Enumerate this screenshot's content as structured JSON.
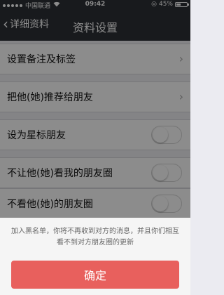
{
  "status_bar": {
    "carrier": "中国联通",
    "time": "09:42",
    "battery": "45%",
    "battery_level": 0.45
  },
  "nav": {
    "back_label": "详细资料",
    "title": "资料设置"
  },
  "rows": {
    "remark_label": "设置备注及标签",
    "recommend_label": "把他(她)推荐给朋友",
    "star_label": "设为星标朋友",
    "block_moments_label": "不让他(她)看我的朋友圈",
    "hide_moments_label": "不看他(她)的朋友圈"
  },
  "sheet": {
    "message": "加入黑名单，你将不再收到对方的消息，并且你们相互看不到对方朋友圈的更新",
    "confirm_label": "确定"
  }
}
